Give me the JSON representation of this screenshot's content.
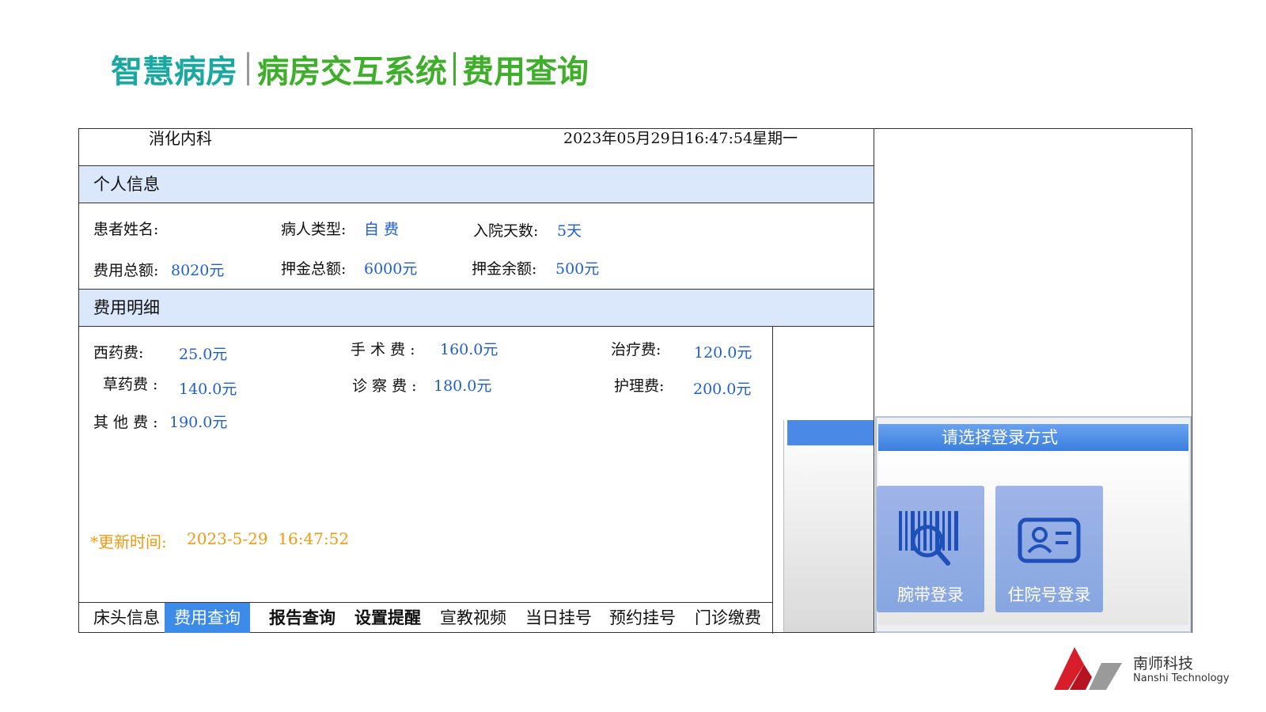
{
  "title": {
    "part1": "智慧病房",
    "part2": "病房交互系统",
    "part3": "费用查询"
  },
  "header": {
    "department": "消化内科",
    "datetime": "2023年05月29日16:47:54星期一"
  },
  "personal": {
    "section_title": "个人信息",
    "name_label": "患者姓名:",
    "type_label": "病人类型:",
    "type_value": "自 费",
    "days_label": "入院天数:",
    "days_value": "5天",
    "total_label": "费用总额:",
    "total_value": "8020元",
    "deposit_label": "押金总额:",
    "deposit_value": "6000元",
    "balance_label": "押金余额:",
    "balance_value": "500元"
  },
  "fees": {
    "section_title": "费用明细",
    "items": [
      {
        "label": "西药费:",
        "value": "25.0元"
      },
      {
        "label": "手 术 费 :",
        "value": "160.0元"
      },
      {
        "label": "治疗费:",
        "value": "120.0元"
      },
      {
        "label": "草药费 :",
        "value": "140.0元"
      },
      {
        "label": "诊 察 费 :",
        "value": "180.0元"
      },
      {
        "label": "护理费:",
        "value": "200.0元"
      },
      {
        "label": "其 他 费 :",
        "value": "190.0元"
      }
    ],
    "update_label": "*更新时间:",
    "update_value": "2023-5-29  16:47:52"
  },
  "tabs": [
    "床头信息",
    "费用查询",
    "报告查询",
    "设置提醒",
    "宣教视频",
    "当日挂号",
    "预约挂号",
    "门诊缴费"
  ],
  "login": {
    "title": "请选择登录方式",
    "wristband": {
      "label": "腕带登录",
      "icon": "barcode-scan-icon"
    },
    "admission": {
      "label": "住院号登录",
      "icon": "id-card-icon"
    }
  },
  "logo": {
    "name_cn": "南师科技",
    "name_en": "Nanshi Technology"
  },
  "colors": {
    "accent_blue": "#3d8be8",
    "value_blue": "#1f5fd6",
    "update_orange": "#f09a12",
    "title_teal": "#1aa8a0",
    "title_green": "#3fae2a"
  }
}
